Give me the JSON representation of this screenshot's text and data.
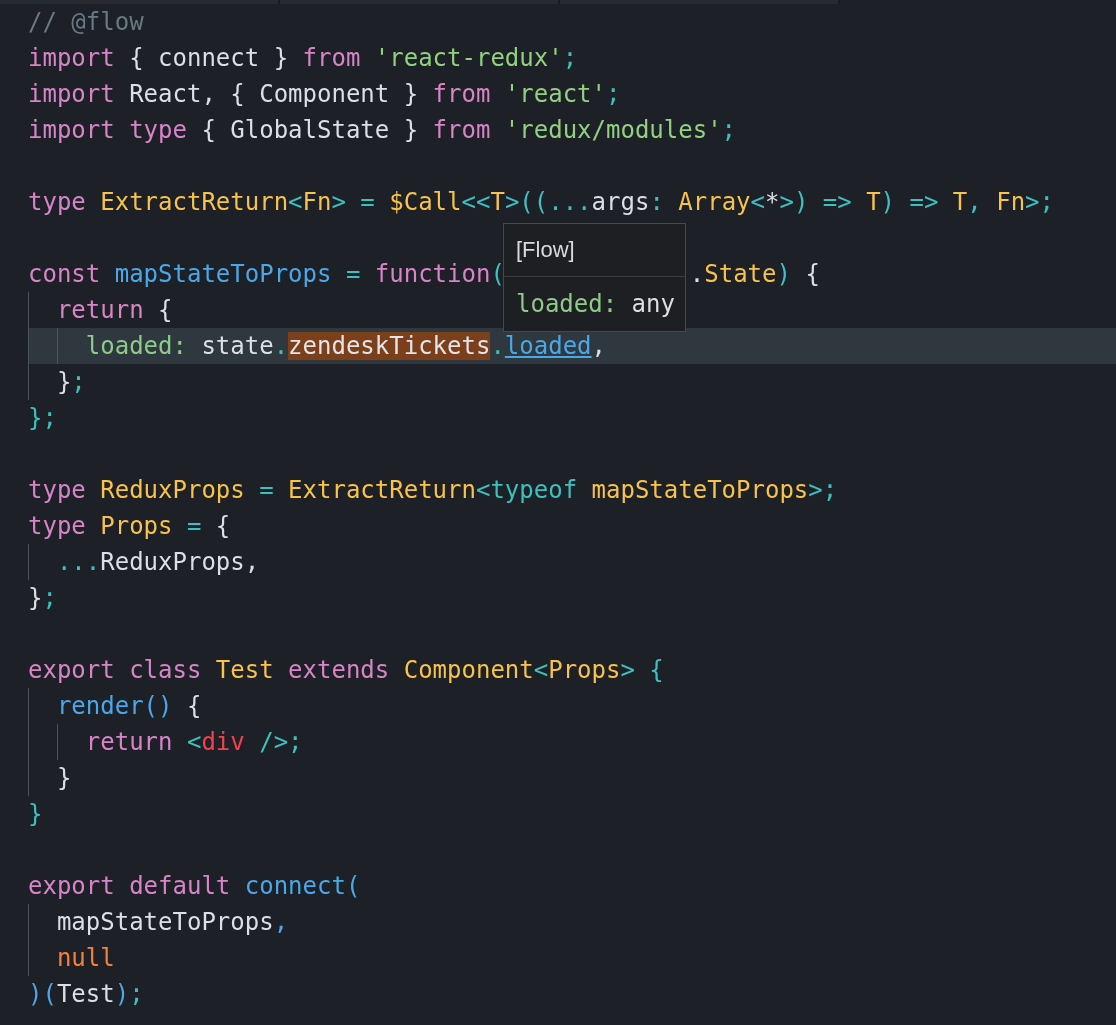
{
  "editor": {
    "lines": [
      {
        "kind": "code",
        "current": false,
        "tokens": [
          {
            "text": "// @flow",
            "kind": "comment"
          }
        ]
      },
      {
        "kind": "code",
        "current": false,
        "tokens": [
          {
            "text": "import",
            "kind": "kw"
          },
          {
            "text": " { connect }",
            "kind": "plain"
          },
          {
            "text": " from",
            "kind": "kw"
          },
          {
            "text": " 'react-redux'",
            "kind": "str"
          },
          {
            "text": ";",
            "kind": "punct"
          }
        ]
      },
      {
        "kind": "code",
        "current": false,
        "tokens": [
          {
            "text": "import",
            "kind": "kw"
          },
          {
            "text": " React, { Component }",
            "kind": "plain"
          },
          {
            "text": " from",
            "kind": "kw"
          },
          {
            "text": " 'react'",
            "kind": "str"
          },
          {
            "text": ";",
            "kind": "punct"
          }
        ]
      },
      {
        "kind": "code",
        "current": false,
        "tokens": [
          {
            "text": "import",
            "kind": "kw"
          },
          {
            "text": " type",
            "kind": "kw"
          },
          {
            "text": " { GlobalState }",
            "kind": "plain"
          },
          {
            "text": " from",
            "kind": "kw"
          },
          {
            "text": " 'redux/modules'",
            "kind": "str"
          },
          {
            "text": ";",
            "kind": "punct"
          }
        ]
      },
      {
        "kind": "blank"
      },
      {
        "kind": "code",
        "current": false,
        "tokens": [
          {
            "text": "type",
            "kind": "kw"
          },
          {
            "text": " ExtractReturn",
            "kind": "type"
          },
          {
            "text": "<",
            "kind": "punct"
          },
          {
            "text": "Fn",
            "kind": "type"
          },
          {
            "text": "> =",
            "kind": "punct"
          },
          {
            "text": " $Call",
            "kind": "type"
          },
          {
            "text": "<<",
            "kind": "punct"
          },
          {
            "text": "T",
            "kind": "type"
          },
          {
            "text": ">((...",
            "kind": "punct"
          },
          {
            "text": "args",
            "kind": "plain"
          },
          {
            "text": ":",
            "kind": "punct"
          },
          {
            "text": " Array",
            "kind": "type"
          },
          {
            "text": "<",
            "kind": "punct"
          },
          {
            "text": "*",
            "kind": "plain"
          },
          {
            "text": ">) =>",
            "kind": "punct"
          },
          {
            "text": " T",
            "kind": "type"
          },
          {
            "text": ") =>",
            "kind": "punct"
          },
          {
            "text": " T",
            "kind": "type"
          },
          {
            "text": ",",
            "kind": "punct"
          },
          {
            "text": " Fn",
            "kind": "type"
          },
          {
            "text": ">;",
            "kind": "punct"
          }
        ]
      },
      {
        "kind": "blank"
      },
      {
        "kind": "code",
        "current": false,
        "tokens": [
          {
            "text": "const",
            "kind": "kw"
          },
          {
            "text": " mapStateToProps",
            "kind": "fn"
          },
          {
            "text": " =",
            "kind": "punct"
          },
          {
            "text": " function",
            "kind": "kw"
          },
          {
            "text": "(",
            "kind": "punct"
          },
          {
            "kind": "covered"
          },
          {
            "text": ".",
            "kind": "plain"
          },
          {
            "text": "State",
            "kind": "type"
          },
          {
            "text": ")",
            "kind": "punct"
          },
          {
            "text": " {",
            "kind": "plain"
          }
        ]
      },
      {
        "kind": "code",
        "current": false,
        "tokens": [
          {
            "text": "  return",
            "kind": "kw"
          },
          {
            "text": " {",
            "kind": "plain"
          }
        ]
      },
      {
        "kind": "code",
        "current": true,
        "tokens": [
          {
            "text": "    loaded:",
            "kind": "prop"
          },
          {
            "text": " state",
            "kind": "plain"
          },
          {
            "text": ".",
            "kind": "punct"
          },
          {
            "text": "zendeskTickets",
            "kind": "match"
          },
          {
            "text": ".",
            "kind": "punct"
          },
          {
            "text": "loaded",
            "kind": "link"
          },
          {
            "text": ",",
            "kind": "plain"
          }
        ]
      },
      {
        "kind": "code",
        "current": false,
        "tokens": [
          {
            "text": "  }",
            "kind": "plain"
          },
          {
            "text": ";",
            "kind": "punct"
          }
        ]
      },
      {
        "kind": "code",
        "current": false,
        "tokens": [
          {
            "text": "};",
            "kind": "punct"
          }
        ]
      },
      {
        "kind": "blank"
      },
      {
        "kind": "code",
        "current": false,
        "tokens": [
          {
            "text": "type",
            "kind": "kw"
          },
          {
            "text": " ReduxProps",
            "kind": "type"
          },
          {
            "text": " =",
            "kind": "punct"
          },
          {
            "text": " ExtractReturn",
            "kind": "type"
          },
          {
            "text": "<typeof",
            "kind": "punct"
          },
          {
            "text": " mapStateToProps",
            "kind": "type"
          },
          {
            "text": ">;",
            "kind": "punct"
          }
        ]
      },
      {
        "kind": "code",
        "current": false,
        "tokens": [
          {
            "text": "type",
            "kind": "kw"
          },
          {
            "text": " Props",
            "kind": "type"
          },
          {
            "text": " =",
            "kind": "punct"
          },
          {
            "text": " {",
            "kind": "plain"
          }
        ]
      },
      {
        "kind": "code",
        "current": false,
        "tokens": [
          {
            "text": "  ...",
            "kind": "punct"
          },
          {
            "text": "ReduxProps,",
            "kind": "plain"
          }
        ]
      },
      {
        "kind": "code",
        "current": false,
        "tokens": [
          {
            "text": "}",
            "kind": "plain"
          },
          {
            "text": ";",
            "kind": "punct"
          }
        ]
      },
      {
        "kind": "blank"
      },
      {
        "kind": "code",
        "current": false,
        "tokens": [
          {
            "text": "export",
            "kind": "kw"
          },
          {
            "text": " class",
            "kind": "kw"
          },
          {
            "text": " Test",
            "kind": "type"
          },
          {
            "text": " extends",
            "kind": "kw"
          },
          {
            "text": " Component",
            "kind": "type"
          },
          {
            "text": "<",
            "kind": "punct"
          },
          {
            "text": "Props",
            "kind": "type"
          },
          {
            "text": "> {",
            "kind": "punct"
          }
        ]
      },
      {
        "kind": "code",
        "current": false,
        "tokens": [
          {
            "text": "  render()",
            "kind": "fn"
          },
          {
            "text": " {",
            "kind": "plain"
          }
        ]
      },
      {
        "kind": "code",
        "current": false,
        "tokens": [
          {
            "text": "    return",
            "kind": "kw"
          },
          {
            "text": " <",
            "kind": "punct"
          },
          {
            "text": "div",
            "kind": "tag"
          },
          {
            "text": " />;",
            "kind": "punct"
          }
        ]
      },
      {
        "kind": "code",
        "current": false,
        "tokens": [
          {
            "text": "  }",
            "kind": "plain"
          }
        ]
      },
      {
        "kind": "code",
        "current": false,
        "tokens": [
          {
            "text": "}",
            "kind": "punct"
          }
        ]
      },
      {
        "kind": "blank"
      },
      {
        "kind": "code",
        "current": false,
        "tokens": [
          {
            "text": "export",
            "kind": "kw"
          },
          {
            "text": " default",
            "kind": "kw"
          },
          {
            "text": " connect(",
            "kind": "fn"
          }
        ]
      },
      {
        "kind": "code",
        "current": false,
        "tokens": [
          {
            "text": "  mapStateToProps",
            "kind": "plain"
          },
          {
            "text": ",",
            "kind": "fn"
          }
        ]
      },
      {
        "kind": "code",
        "current": false,
        "tokens": [
          {
            "text": "  null",
            "kind": "const"
          }
        ]
      },
      {
        "kind": "code",
        "current": false,
        "tokens": [
          {
            "text": ")(",
            "kind": "fn"
          },
          {
            "text": "Test",
            "kind": "plain"
          },
          {
            "text": ")",
            "kind": "fn"
          },
          {
            "text": ";",
            "kind": "punct"
          }
        ]
      }
    ]
  },
  "tooltip": {
    "title": "[Flow]",
    "tokens": [
      {
        "text": "loaded:",
        "kind": "prop"
      },
      {
        "text": " any",
        "kind": "plain"
      }
    ]
  }
}
